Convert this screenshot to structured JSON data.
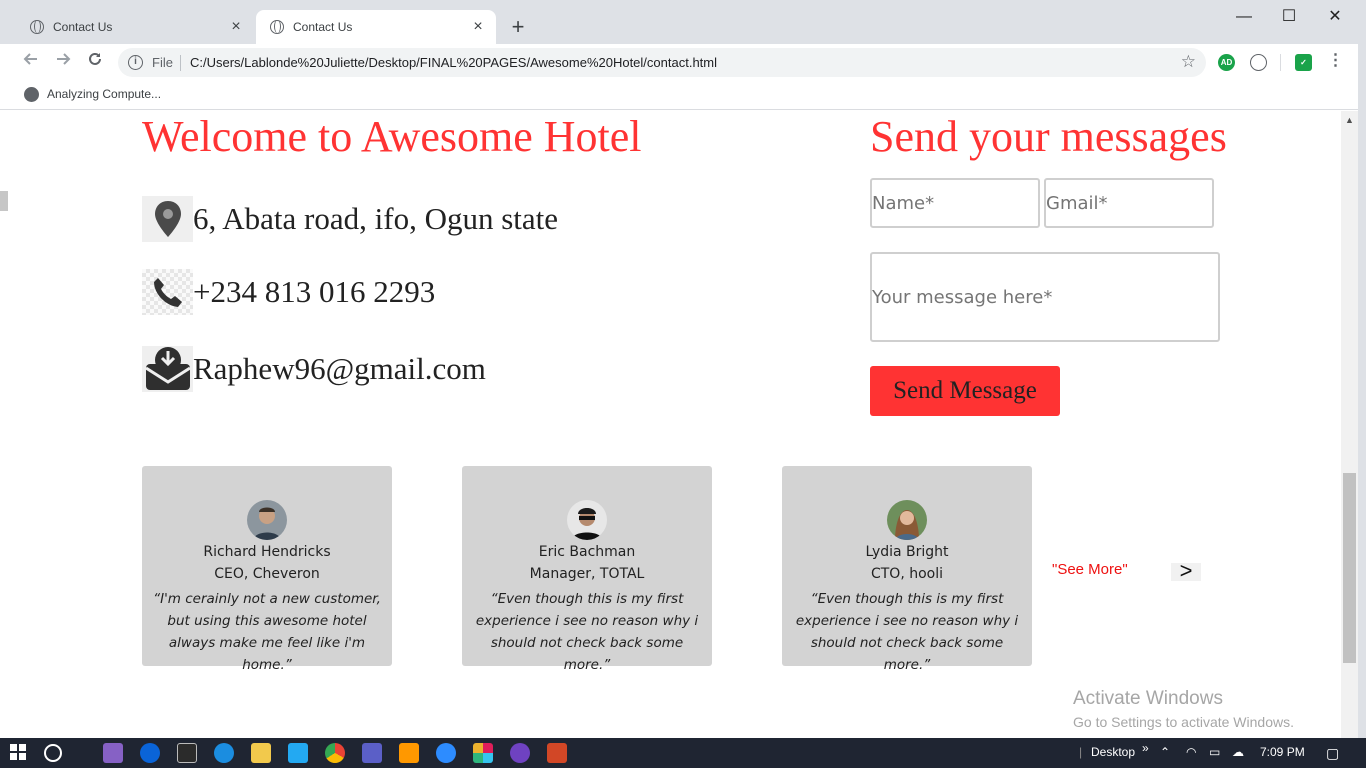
{
  "browser": {
    "tabs": [
      {
        "title": "Contact Us",
        "active": false
      },
      {
        "title": "Contact Us",
        "active": true
      }
    ],
    "new_tab": "+",
    "window_controls": {
      "minimize": "—",
      "maximize": "☐",
      "close": "✕"
    },
    "address": {
      "scheme": "File",
      "url": "C:/Users/Lablonde%20Juliette/Desktop/FINAL%20PAGES/Awesome%20Hotel/contact.html"
    },
    "extensions": [
      {
        "icon": "adblock-icon",
        "label": "AD",
        "color": "#1aa34a"
      },
      {
        "icon": "drive-icon",
        "color": "#5f6368"
      },
      {
        "icon": "shield-check-icon",
        "color": "#1aa34a"
      }
    ],
    "bookmark": {
      "label": "Analyzing Compute..."
    }
  },
  "page": {
    "welcome_title": "Welcome to Awesome Hotel",
    "send_title": "Send your messages",
    "contact_info": [
      {
        "icon": "location-pin-icon",
        "text": "6, Abata road, ifo, Ogun state"
      },
      {
        "icon": "phone-icon",
        "text": "+234 813 016 2293"
      },
      {
        "icon": "mail-download-icon",
        "text": "Raphew96@gmail.com"
      }
    ],
    "form": {
      "name_placeholder": "Name*",
      "gmail_placeholder": "Gmail*",
      "message_placeholder": "Your message here*",
      "submit_label": "Send Message"
    },
    "testimonials": [
      {
        "name": "Richard Hendricks",
        "role": "CEO, Cheveron",
        "quote": "“I'm cerainly not a new customer, but using this awesome hotel always make me feel like i'm home.”"
      },
      {
        "name": "Eric Bachman",
        "role": "Manager, TOTAL",
        "quote": "“Even though this is my first experience i see no reason why i should not check back some more.”"
      },
      {
        "name": "Lydia Bright",
        "role": "CTO, hooli",
        "quote": "“Even though this is my first experience i see no reason why i should not check back some more.”"
      }
    ],
    "see_more": "\"See More\"",
    "next": ">",
    "activate_windows": {
      "title": "Activate Windows",
      "subtitle": "Go to Settings to activate Windows."
    }
  },
  "taskbar": {
    "desktop_label": "Desktop",
    "chevron": "»",
    "time": "7:09 PM"
  },
  "colors": {
    "accent": "#ff3333",
    "card_bg": "#d3d3d3"
  }
}
